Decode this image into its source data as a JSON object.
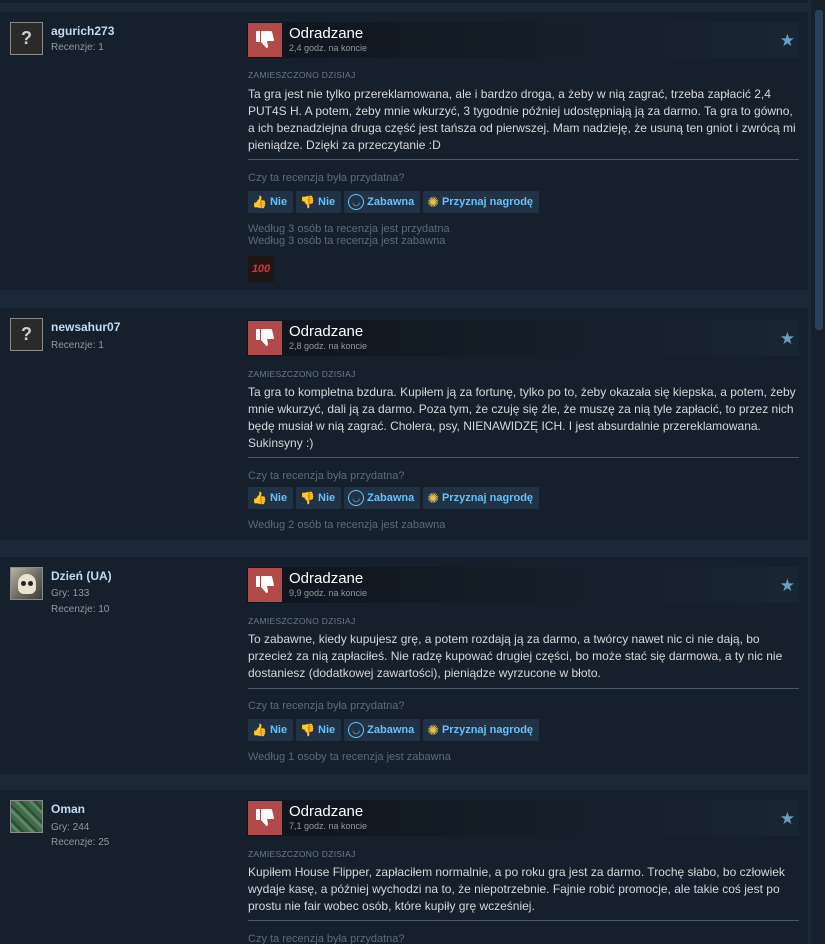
{
  "common": {
    "verdict": "Odradzane",
    "posted": "ZAMIESZCZONO DZISIAJ",
    "helpful_question": "Czy ta recenzja była przydatna?",
    "btn_yes": "Nie",
    "btn_no": "Nie",
    "btn_funny": "Zabawna",
    "btn_award": "Przyznaj nagrodę",
    "thumbs_color": "#b24a4a",
    "link_color": "#67c1f5"
  },
  "reviews": [
    {
      "user": "agurich273",
      "meta": [
        "Recenzje: 1"
      ],
      "hours": "2,4 godz. na koncie",
      "text": "Ta gra jest nie tylko przereklamowana, ale i bardzo droga, a żeby w nią zagrać, trzeba zapłacić 2,4 PUT4S H. A potem, żeby mnie wkurzyć, 3 tygodnie później udostępniają ją za darmo. Ta gra to gówno, a ich beznadziejna druga część jest tańsza od pierwszej. Mam nadzieję, że usuną ten gniot i zwrócą mi pieniądze. Dzięki za przeczytanie :D",
      "counts": [
        "Według 3 osób ta recenzja jest przydatna",
        "Według 3 osób ta recenzja jest zabawna"
      ],
      "award": "100"
    },
    {
      "user": "newsahur07",
      "meta": [
        "Recenzje: 1"
      ],
      "hours": "2,8 godz. na koncie",
      "text": "Ta gra to kompletna bzdura. Kupiłem ją za fortunę, tylko po to, żeby okazała się kiepska, a potem, żeby mnie wkurzyć, dali ją za darmo. Poza tym, że czuję się źle, że muszę za nią tyle zapłacić, to przez nich będę musiał w nią zagrać. Cholera, psy, NIENAWIDZĘ ICH. I jest absurdalnie przereklamowana. Sukinsyny :)",
      "counts": [
        "Według 2 osób ta recenzja jest zabawna"
      ]
    },
    {
      "user": "Dzień (UA)",
      "meta": [
        "Gry: 133",
        "Recenzje: 10"
      ],
      "hours": "9,9 godz. na koncie",
      "text": "To zabawne, kiedy kupujesz grę, a potem rozdają ją za darmo, a twórcy nawet nic ci nie dają, bo przecież za nią zapłaciłeś. Nie radzę kupować drugiej części, bo może stać się darmowa, a ty nic nie dostaniesz (dodatkowej zawartości), pieniądze wyrzucone w błoto.",
      "counts": [
        "Według 1 osoby ta recenzja jest zabawna"
      ]
    },
    {
      "user": "Oman",
      "meta": [
        "Gry: 244",
        "Recenzje: 25"
      ],
      "hours": "7,1 godz. na koncie",
      "text": "Kupiłem House Flipper, zapłaciłem normalnie, a po roku gra jest za darmo. Trochę słabo, bo człowiek wydaje kasę, a później wychodzi na to, że niepotrzebnie. Fajnie robić promocje, ale takie coś jest po prostu nie fair wobec osób, które kupiły grę wcześniej.",
      "counts": []
    }
  ]
}
